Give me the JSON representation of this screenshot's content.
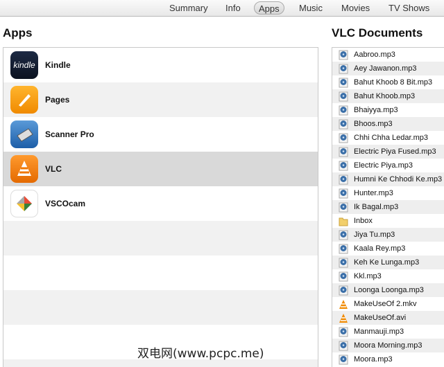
{
  "tabs": [
    "Summary",
    "Info",
    "Apps",
    "Music",
    "Movies",
    "TV Shows"
  ],
  "active_tab": "Apps",
  "apps_title": "Apps",
  "apps": [
    {
      "name": "Kindle",
      "icon": "kindle",
      "icon_text": "kindle"
    },
    {
      "name": "Pages",
      "icon": "pages"
    },
    {
      "name": "Scanner Pro",
      "icon": "scanner"
    },
    {
      "name": "VLC",
      "icon": "vlc",
      "selected": true
    },
    {
      "name": "VSCOcam",
      "icon": "vsco"
    }
  ],
  "docs_title": "VLC Documents",
  "documents": [
    {
      "name": "Aabroo.mp3",
      "type": "mp3"
    },
    {
      "name": "Aey Jawanon.mp3",
      "type": "mp3"
    },
    {
      "name": "Bahut Khoob 8 Bit.mp3",
      "type": "mp3"
    },
    {
      "name": "Bahut Khoob.mp3",
      "type": "mp3"
    },
    {
      "name": "Bhaiyya.mp3",
      "type": "mp3"
    },
    {
      "name": "Bhoos.mp3",
      "type": "mp3"
    },
    {
      "name": "Chhi Chha Ledar.mp3",
      "type": "mp3"
    },
    {
      "name": "Electric Piya Fused.mp3",
      "type": "mp3"
    },
    {
      "name": "Electric Piya.mp3",
      "type": "mp3"
    },
    {
      "name": "Humni Ke Chhodi Ke.mp3",
      "type": "mp3"
    },
    {
      "name": "Hunter.mp3",
      "type": "mp3"
    },
    {
      "name": "Ik Bagal.mp3",
      "type": "mp3"
    },
    {
      "name": "Inbox",
      "type": "folder"
    },
    {
      "name": "Jiya Tu.mp3",
      "type": "mp3"
    },
    {
      "name": "Kaala Rey.mp3",
      "type": "mp3"
    },
    {
      "name": "Keh Ke Lunga.mp3",
      "type": "mp3"
    },
    {
      "name": "Kkl.mp3",
      "type": "mp3"
    },
    {
      "name": "Loonga Loonga.mp3",
      "type": "mp3"
    },
    {
      "name": "MakeUseOf 2.mkv",
      "type": "video"
    },
    {
      "name": "MakeUseOf.avi",
      "type": "video"
    },
    {
      "name": "Manmauji.mp3",
      "type": "mp3"
    },
    {
      "name": "Moora Morning.mp3",
      "type": "mp3"
    },
    {
      "name": "Moora.mp3",
      "type": "mp3"
    }
  ],
  "watermark": "双电网(www.pcpc.me)"
}
